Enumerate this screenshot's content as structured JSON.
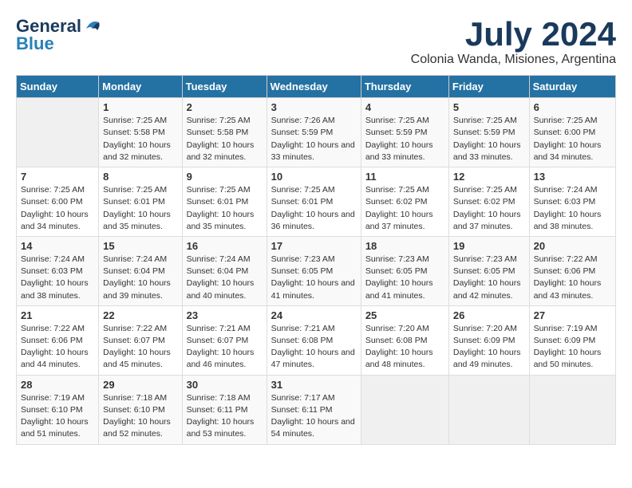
{
  "header": {
    "logo_general": "General",
    "logo_blue": "Blue",
    "month_year": "July 2024",
    "location": "Colonia Wanda, Misiones, Argentina"
  },
  "weekdays": [
    "Sunday",
    "Monday",
    "Tuesday",
    "Wednesday",
    "Thursday",
    "Friday",
    "Saturday"
  ],
  "weeks": [
    [
      {
        "day": "",
        "sunrise": "",
        "sunset": "",
        "daylight": ""
      },
      {
        "day": "1",
        "sunrise": "Sunrise: 7:25 AM",
        "sunset": "Sunset: 5:58 PM",
        "daylight": "Daylight: 10 hours and 32 minutes."
      },
      {
        "day": "2",
        "sunrise": "Sunrise: 7:25 AM",
        "sunset": "Sunset: 5:58 PM",
        "daylight": "Daylight: 10 hours and 32 minutes."
      },
      {
        "day": "3",
        "sunrise": "Sunrise: 7:26 AM",
        "sunset": "Sunset: 5:59 PM",
        "daylight": "Daylight: 10 hours and 33 minutes."
      },
      {
        "day": "4",
        "sunrise": "Sunrise: 7:25 AM",
        "sunset": "Sunset: 5:59 PM",
        "daylight": "Daylight: 10 hours and 33 minutes."
      },
      {
        "day": "5",
        "sunrise": "Sunrise: 7:25 AM",
        "sunset": "Sunset: 5:59 PM",
        "daylight": "Daylight: 10 hours and 33 minutes."
      },
      {
        "day": "6",
        "sunrise": "Sunrise: 7:25 AM",
        "sunset": "Sunset: 6:00 PM",
        "daylight": "Daylight: 10 hours and 34 minutes."
      }
    ],
    [
      {
        "day": "7",
        "sunrise": "Sunrise: 7:25 AM",
        "sunset": "Sunset: 6:00 PM",
        "daylight": "Daylight: 10 hours and 34 minutes."
      },
      {
        "day": "8",
        "sunrise": "Sunrise: 7:25 AM",
        "sunset": "Sunset: 6:01 PM",
        "daylight": "Daylight: 10 hours and 35 minutes."
      },
      {
        "day": "9",
        "sunrise": "Sunrise: 7:25 AM",
        "sunset": "Sunset: 6:01 PM",
        "daylight": "Daylight: 10 hours and 35 minutes."
      },
      {
        "day": "10",
        "sunrise": "Sunrise: 7:25 AM",
        "sunset": "Sunset: 6:01 PM",
        "daylight": "Daylight: 10 hours and 36 minutes."
      },
      {
        "day": "11",
        "sunrise": "Sunrise: 7:25 AM",
        "sunset": "Sunset: 6:02 PM",
        "daylight": "Daylight: 10 hours and 37 minutes."
      },
      {
        "day": "12",
        "sunrise": "Sunrise: 7:25 AM",
        "sunset": "Sunset: 6:02 PM",
        "daylight": "Daylight: 10 hours and 37 minutes."
      },
      {
        "day": "13",
        "sunrise": "Sunrise: 7:24 AM",
        "sunset": "Sunset: 6:03 PM",
        "daylight": "Daylight: 10 hours and 38 minutes."
      }
    ],
    [
      {
        "day": "14",
        "sunrise": "Sunrise: 7:24 AM",
        "sunset": "Sunset: 6:03 PM",
        "daylight": "Daylight: 10 hours and 38 minutes."
      },
      {
        "day": "15",
        "sunrise": "Sunrise: 7:24 AM",
        "sunset": "Sunset: 6:04 PM",
        "daylight": "Daylight: 10 hours and 39 minutes."
      },
      {
        "day": "16",
        "sunrise": "Sunrise: 7:24 AM",
        "sunset": "Sunset: 6:04 PM",
        "daylight": "Daylight: 10 hours and 40 minutes."
      },
      {
        "day": "17",
        "sunrise": "Sunrise: 7:23 AM",
        "sunset": "Sunset: 6:05 PM",
        "daylight": "Daylight: 10 hours and 41 minutes."
      },
      {
        "day": "18",
        "sunrise": "Sunrise: 7:23 AM",
        "sunset": "Sunset: 6:05 PM",
        "daylight": "Daylight: 10 hours and 41 minutes."
      },
      {
        "day": "19",
        "sunrise": "Sunrise: 7:23 AM",
        "sunset": "Sunset: 6:05 PM",
        "daylight": "Daylight: 10 hours and 42 minutes."
      },
      {
        "day": "20",
        "sunrise": "Sunrise: 7:22 AM",
        "sunset": "Sunset: 6:06 PM",
        "daylight": "Daylight: 10 hours and 43 minutes."
      }
    ],
    [
      {
        "day": "21",
        "sunrise": "Sunrise: 7:22 AM",
        "sunset": "Sunset: 6:06 PM",
        "daylight": "Daylight: 10 hours and 44 minutes."
      },
      {
        "day": "22",
        "sunrise": "Sunrise: 7:22 AM",
        "sunset": "Sunset: 6:07 PM",
        "daylight": "Daylight: 10 hours and 45 minutes."
      },
      {
        "day": "23",
        "sunrise": "Sunrise: 7:21 AM",
        "sunset": "Sunset: 6:07 PM",
        "daylight": "Daylight: 10 hours and 46 minutes."
      },
      {
        "day": "24",
        "sunrise": "Sunrise: 7:21 AM",
        "sunset": "Sunset: 6:08 PM",
        "daylight": "Daylight: 10 hours and 47 minutes."
      },
      {
        "day": "25",
        "sunrise": "Sunrise: 7:20 AM",
        "sunset": "Sunset: 6:08 PM",
        "daylight": "Daylight: 10 hours and 48 minutes."
      },
      {
        "day": "26",
        "sunrise": "Sunrise: 7:20 AM",
        "sunset": "Sunset: 6:09 PM",
        "daylight": "Daylight: 10 hours and 49 minutes."
      },
      {
        "day": "27",
        "sunrise": "Sunrise: 7:19 AM",
        "sunset": "Sunset: 6:09 PM",
        "daylight": "Daylight: 10 hours and 50 minutes."
      }
    ],
    [
      {
        "day": "28",
        "sunrise": "Sunrise: 7:19 AM",
        "sunset": "Sunset: 6:10 PM",
        "daylight": "Daylight: 10 hours and 51 minutes."
      },
      {
        "day": "29",
        "sunrise": "Sunrise: 7:18 AM",
        "sunset": "Sunset: 6:10 PM",
        "daylight": "Daylight: 10 hours and 52 minutes."
      },
      {
        "day": "30",
        "sunrise": "Sunrise: 7:18 AM",
        "sunset": "Sunset: 6:11 PM",
        "daylight": "Daylight: 10 hours and 53 minutes."
      },
      {
        "day": "31",
        "sunrise": "Sunrise: 7:17 AM",
        "sunset": "Sunset: 6:11 PM",
        "daylight": "Daylight: 10 hours and 54 minutes."
      },
      {
        "day": "",
        "sunrise": "",
        "sunset": "",
        "daylight": ""
      },
      {
        "day": "",
        "sunrise": "",
        "sunset": "",
        "daylight": ""
      },
      {
        "day": "",
        "sunrise": "",
        "sunset": "",
        "daylight": ""
      }
    ]
  ]
}
